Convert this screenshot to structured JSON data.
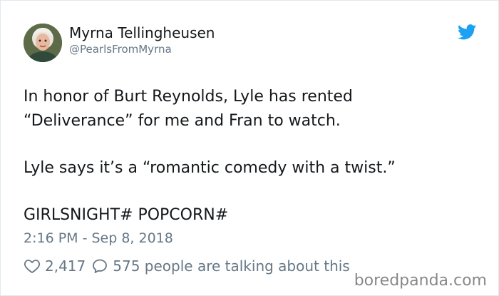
{
  "author": {
    "name": "Myrna Tellingheusen",
    "handle": "@PearlsFromMyrna",
    "avatar_icon": "elderly-woman-avatar"
  },
  "brand": {
    "icon": "twitter-bird-icon",
    "color": "#1da1f2"
  },
  "tweet": {
    "paragraphs": [
      "In honor of Burt Reynolds, Lyle has rented",
      "“Deliverance” for me and Fran to watch.",
      "Lyle says it’s a “romantic comedy with a twist.”",
      "GIRLSNIGHT# POPCORN#"
    ],
    "timestamp": "2:16 PM - Sep 8, 2018"
  },
  "engagement": {
    "likes": "2,417",
    "comments_text": "575 people are talking about this"
  },
  "watermark": "boredpanda.com"
}
